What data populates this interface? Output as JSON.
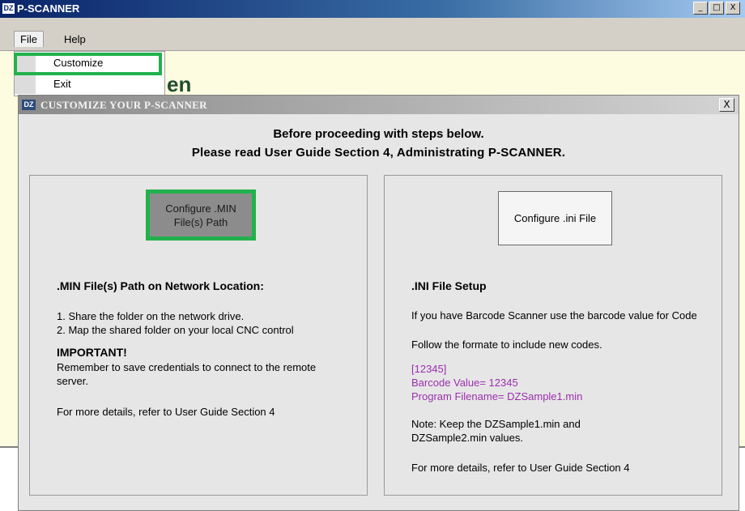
{
  "app": {
    "logo": "DZ",
    "title": "P-SCANNER",
    "window_buttons": [
      "_",
      "□",
      "X"
    ]
  },
  "menubar": {
    "file": "File",
    "help": "Help"
  },
  "file_menu": {
    "customize": "Customize",
    "exit": "Exit"
  },
  "background_fragment": "en",
  "dialog": {
    "logo": "DZ",
    "title": "CUSTOMIZE YOUR P-SCANNER",
    "close": "X",
    "heading_line1": "Before proceeding with steps below.",
    "heading_line2": "Please read User Guide Section 4, Administrating P-SCANNER.",
    "left_panel": {
      "button": "Configure .MIN File(s) Path",
      "heading": ".MIN File(s) Path on Network Location:",
      "step1": "1. Share the folder on the network drive.",
      "step2": "2. Map the shared folder on your local CNC control",
      "important": "IMPORTANT!",
      "important_text": "Remember to save credentials to connect to the remote server.",
      "more_details": "For more details, refer to User Guide Section 4"
    },
    "right_panel": {
      "button": "Configure .ini File",
      "heading": ".INI File Setup",
      "intro": "If you have Barcode Scanner use the barcode value for Code",
      "follow": "Follow the formate to include new codes.",
      "code_line": "[12345]",
      "barcode_line": "Barcode Value= 12345",
      "program_line": "Program Filename= DZSample1.min",
      "note": "Note: Keep the DZSample1.min and DZSample2.min values.",
      "more_details": "For more details, refer to User Guide Section 4"
    }
  },
  "colors": {
    "highlight": "#22b14c",
    "sample_text": "#9b2fae"
  }
}
